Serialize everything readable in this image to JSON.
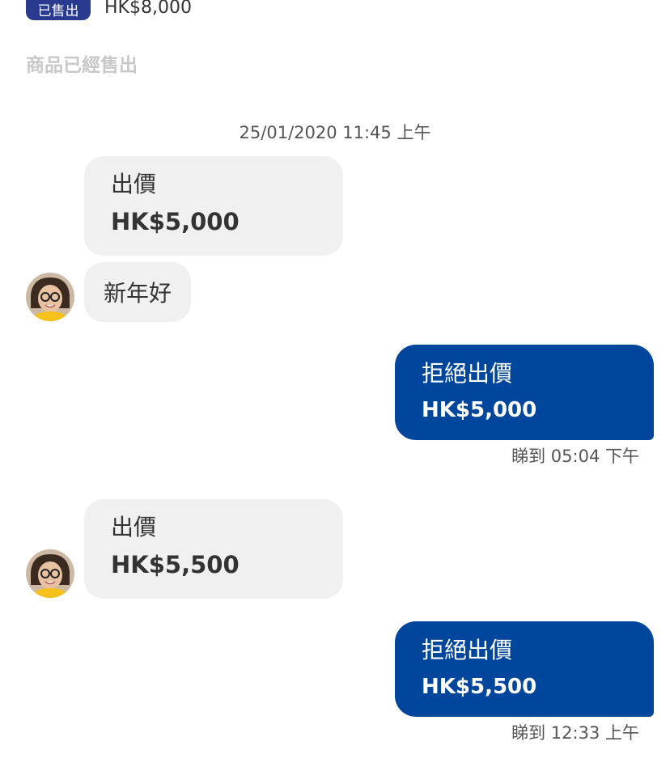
{
  "listing": {
    "sold_badge": "已售出",
    "price": "HK$8,000",
    "sold_status": "商品已經售出"
  },
  "chat": {
    "timestamp": "25/01/2020 11:45 上午",
    "messages": [
      {
        "sender": "other",
        "type": "offer",
        "label": "出價",
        "amount": "HK$5,000"
      },
      {
        "sender": "other",
        "type": "text",
        "text": "新年好"
      },
      {
        "sender": "me",
        "type": "reject",
        "label": "拒絕出價",
        "amount": "HK$5,000",
        "receipt": "睇到 05:04 下午"
      },
      {
        "sender": "other",
        "type": "offer",
        "label": "出價",
        "amount": "HK$5,500"
      },
      {
        "sender": "me",
        "type": "reject",
        "label": "拒絕出價",
        "amount": "HK$5,500",
        "receipt": "睇到 12:33 上午"
      }
    ]
  }
}
